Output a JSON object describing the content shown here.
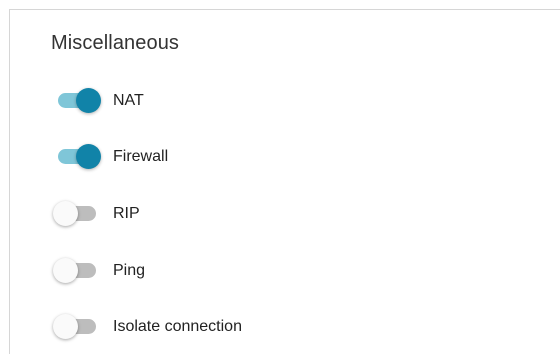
{
  "section": {
    "title": "Miscellaneous"
  },
  "toggles": [
    {
      "label": "NAT",
      "enabled": true
    },
    {
      "label": "Firewall",
      "enabled": true
    },
    {
      "label": "RIP",
      "enabled": false
    },
    {
      "label": "Ping",
      "enabled": false
    },
    {
      "label": "Isolate connection",
      "enabled": false
    }
  ],
  "colors": {
    "toggle_on_knob": "#1183a8",
    "toggle_on_track": "#7fc6d8",
    "toggle_off_knob": "#fafafa",
    "toggle_off_track": "#bdbdbd"
  }
}
